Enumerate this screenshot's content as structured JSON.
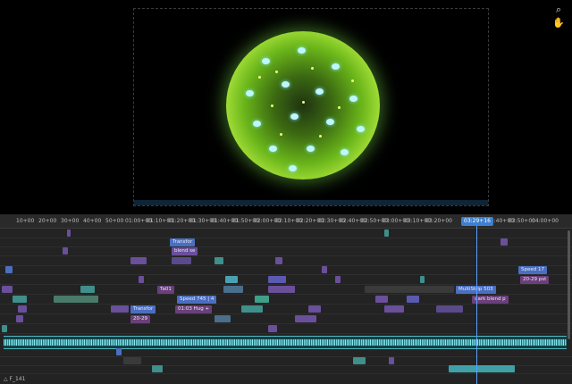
{
  "viewer": {
    "zoom_tool": "zoom-icon",
    "hand_tool": "hand-icon"
  },
  "ruler": {
    "ticks": [
      "10+00",
      "20+00",
      "30+00",
      "40+00",
      "50+00",
      "01:00+00",
      "01:10+00",
      "01:20+00",
      "01:30+00",
      "01:40+00",
      "01:50+00",
      "02:00+00",
      "02:10+00",
      "02:20+00",
      "02:30+00",
      "02:40+00",
      "02:50+00",
      "03:00+00",
      "03:10+00",
      "03:20+00",
      "03:40+00",
      "03:50+00",
      "04:00+00"
    ],
    "playhead": "03:29+16"
  },
  "clips": {
    "transform_1": "Transfor",
    "blend_1": "blend se",
    "speed_1": "Speed 17",
    "range_1": "20-29 pst",
    "speed_2": "Speed 745 | 4",
    "label_1": "01:03 Hug +",
    "transform_2": "Transfor",
    "range_2": "20-29",
    "multistrip": "MultiStrip 503",
    "dark_blend": "dark blend p",
    "small_1": "Ta01"
  },
  "status": {
    "text": "F_141"
  },
  "colors": {
    "clip_purple": "#6a4f9a",
    "clip_teal": "#3f8f8a",
    "clip_blue": "#4a6fc0",
    "playhead": "#3d7fd0",
    "audio": "#4fb8c0"
  }
}
